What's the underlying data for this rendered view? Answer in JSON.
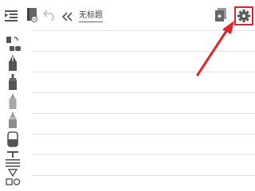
{
  "document": {
    "title": "无标题"
  },
  "header": {
    "menu_icon": "menu-lines-icon",
    "notebook_icon": "notebook-icon",
    "undo_icon": "undo-arrow-icon",
    "collapse_icon": "double-chevron-left-icon",
    "add_page_icon": "add-page-icon",
    "settings_icon": "gear-icon"
  },
  "tools": [
    {
      "name": "eraser-swap-tool",
      "icon": "eraser-swap-icon"
    },
    {
      "name": "fountain-pen-tool",
      "icon": "fountain-pen-icon"
    },
    {
      "name": "marker-tool",
      "icon": "marker-icon"
    },
    {
      "name": "highlighter-tool",
      "icon": "highlighter-icon"
    },
    {
      "name": "brush-tool",
      "icon": "brush-icon"
    },
    {
      "name": "eraser-tool",
      "icon": "eraser-icon"
    },
    {
      "name": "text-tool",
      "icon": "text-icon"
    },
    {
      "name": "shapes-tool",
      "icon": "shapes-icon"
    }
  ],
  "annotation": {
    "highlight_color": "#e0222a"
  }
}
